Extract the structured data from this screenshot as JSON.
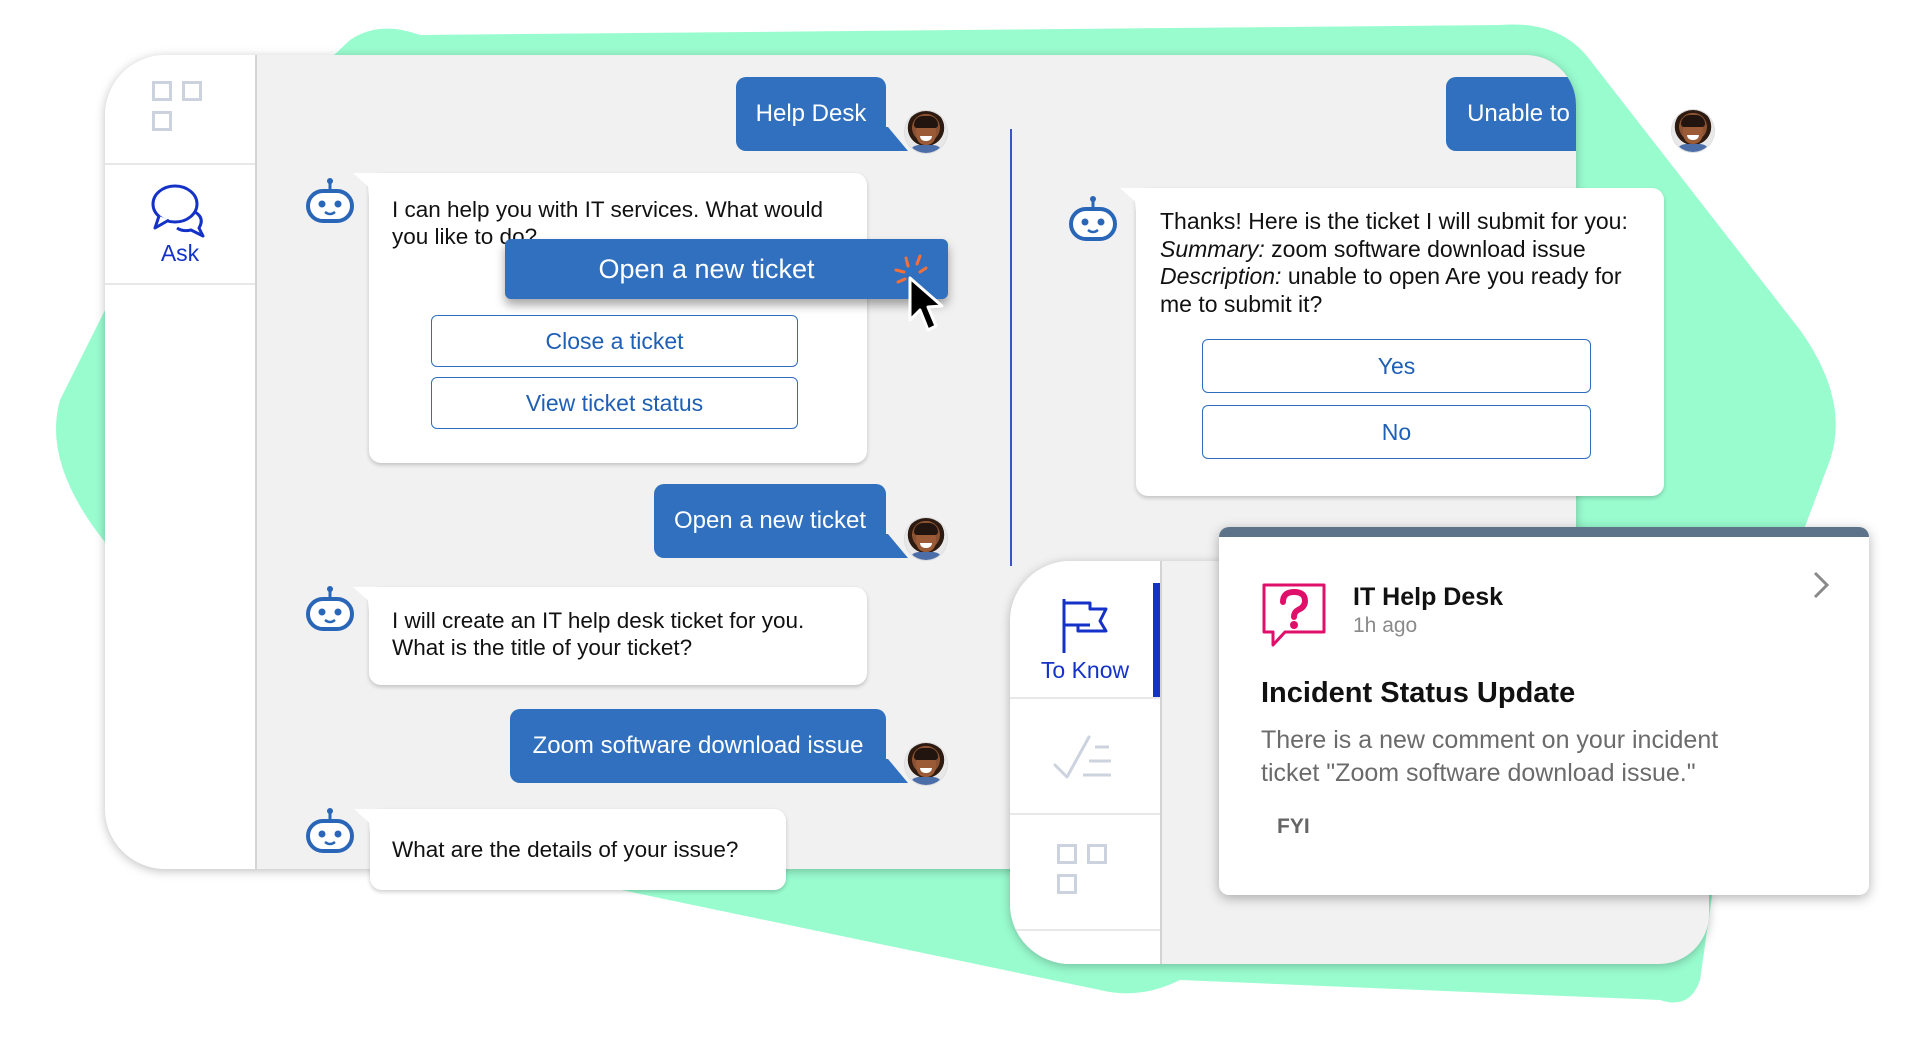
{
  "colors": {
    "accent_blue": "#3070be",
    "nav_blue": "#1432c8",
    "mint_background": "#99fccf",
    "window_bg": "#f1f1f1",
    "alert_pink": "#e0106a",
    "cursor_click_orange": "#f2703c"
  },
  "left_sidebar": {
    "items": [
      {
        "icon": "apps-grid-icon",
        "label": ""
      },
      {
        "icon": "chat-bubbles-icon",
        "label": "Ask",
        "active": true
      }
    ]
  },
  "conversation_left": {
    "messages": [
      {
        "from": "user",
        "text": "Help Desk"
      },
      {
        "from": "bot",
        "text": "I can help you with IT services. What would you like to do?",
        "options": [
          "Open a new ticket",
          "Close a ticket",
          "View ticket status"
        ],
        "highlighted_option": "Open a new ticket"
      },
      {
        "from": "user",
        "text": "Open a new ticket"
      },
      {
        "from": "bot",
        "text": "I will create an IT help desk ticket for you. What is the title of your ticket?"
      },
      {
        "from": "user",
        "text": "Zoom software download issue"
      },
      {
        "from": "bot",
        "text": "What are the details of your issue?"
      }
    ]
  },
  "conversation_right": {
    "user_message": "Unable to open",
    "bot_message": {
      "intro": "Thanks! Here is the ticket I will submit for you: ",
      "summary_label": "Summary:",
      "summary_value": " zoom software download issue ",
      "description_label": "Description:",
      "description_value": " unable to open Are you ready for me to submit it?"
    },
    "options": [
      "Yes",
      "No"
    ]
  },
  "second_sidebar": {
    "items": [
      {
        "icon": "flag-icon",
        "label": "To Know",
        "active": true
      },
      {
        "icon": "checklist-icon",
        "label": ""
      },
      {
        "icon": "apps-grid-icon",
        "label": ""
      }
    ]
  },
  "notification": {
    "source": "IT Help Desk",
    "time": "1h ago",
    "title": "Incident Status Update",
    "body": "There is a new comment on your incident ticket \"Zoom software download issue.\"",
    "tag": "FYI"
  }
}
